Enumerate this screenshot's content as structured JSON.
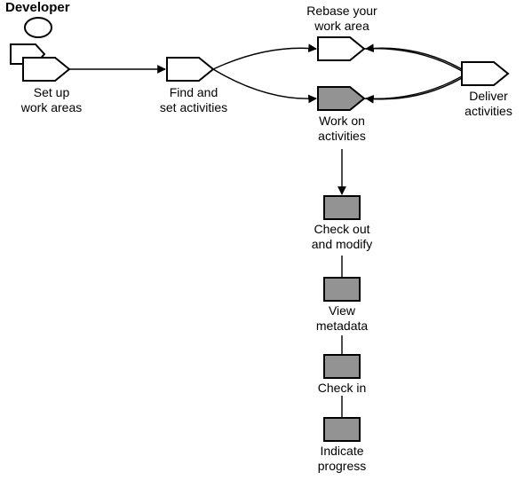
{
  "diagram": {
    "actor": "Developer",
    "nodes": {
      "setup": {
        "label": "Set up\nwork areas"
      },
      "find": {
        "label": "Find and\nset activities"
      },
      "rebase": {
        "label": "Rebase your\nwork area"
      },
      "workon": {
        "label": "Work on\nactivities"
      },
      "deliver": {
        "label": "Deliver\nactivities"
      },
      "checkout": {
        "label": "Check out\nand modify"
      },
      "view": {
        "label": "View\nmetadata"
      },
      "checkin": {
        "label": "Check in"
      },
      "indicate": {
        "label": "Indicate\nprogress"
      }
    }
  },
  "chart_data": {
    "type": "workflow-diagram",
    "actor": "Developer",
    "nodes": [
      {
        "id": "setup",
        "label": "Set up work areas",
        "shape": "pentagon",
        "fill": "white"
      },
      {
        "id": "find",
        "label": "Find and set activities",
        "shape": "pentagon",
        "fill": "white"
      },
      {
        "id": "rebase",
        "label": "Rebase your work area",
        "shape": "pentagon",
        "fill": "white"
      },
      {
        "id": "workon",
        "label": "Work on activities",
        "shape": "pentagon",
        "fill": "gray"
      },
      {
        "id": "deliver",
        "label": "Deliver activities",
        "shape": "pentagon",
        "fill": "white"
      },
      {
        "id": "checkout",
        "label": "Check out and modify",
        "shape": "rect",
        "fill": "gray"
      },
      {
        "id": "view",
        "label": "View metadata",
        "shape": "rect",
        "fill": "gray"
      },
      {
        "id": "checkin",
        "label": "Check in",
        "shape": "rect",
        "fill": "gray"
      },
      {
        "id": "indicate",
        "label": "Indicate progress",
        "shape": "rect",
        "fill": "gray"
      }
    ],
    "edges": [
      {
        "from": "actor",
        "to": "setup",
        "style": "implicit"
      },
      {
        "from": "setup",
        "to": "find",
        "style": "arrow"
      },
      {
        "from": "find",
        "to": "rebase",
        "style": "arrow-curve-up"
      },
      {
        "from": "find",
        "to": "workon",
        "style": "arrow-curve-down"
      },
      {
        "from": "rebase",
        "to": "deliver",
        "style": "continue-curve"
      },
      {
        "from": "workon",
        "to": "deliver",
        "style": "continue-curve"
      },
      {
        "from": "deliver",
        "to": "rebase",
        "style": "arrow-curve-back-up"
      },
      {
        "from": "deliver",
        "to": "workon",
        "style": "arrow-curve-back-down"
      },
      {
        "from": "workon",
        "to": "checkout",
        "style": "arrow-down"
      },
      {
        "from": "checkout",
        "to": "view",
        "style": "line"
      },
      {
        "from": "view",
        "to": "checkin",
        "style": "line"
      },
      {
        "from": "checkin",
        "to": "indicate",
        "style": "line"
      }
    ]
  }
}
